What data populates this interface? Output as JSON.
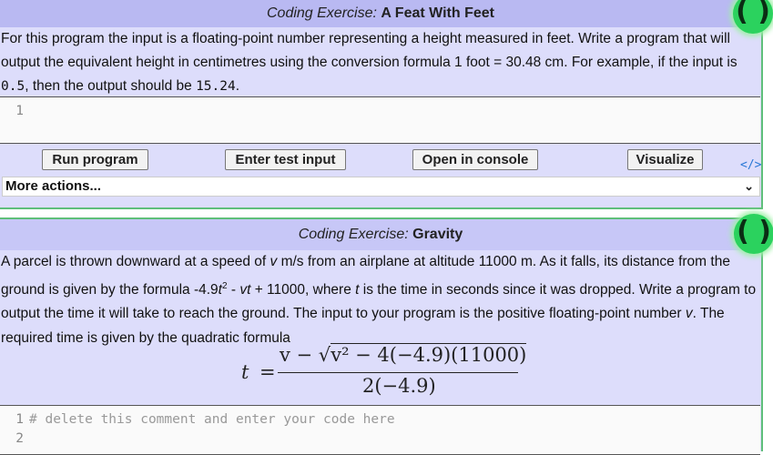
{
  "exercise1": {
    "title_prefix": "Coding Exercise:",
    "title_name": "A Feat With Feet",
    "desc_part1": "For this program the input is a floating-point number representing a height measured in feet. Write a program that will output the equivalent height in centimetres using the conversion formula 1 foot = 30.48 cm. For example, if the input is ",
    "example_input": "0.5",
    "desc_part2": ", then the output should be ",
    "example_output": "15.24",
    "desc_part3": ".",
    "editor_line_numbers": [
      "1"
    ],
    "editor_lines": [
      ""
    ],
    "buttons": {
      "run": "Run program",
      "test": "Enter test input",
      "console": "Open in console",
      "visualize": "Visualize"
    },
    "more_actions": "More actions...",
    "code_icon": "</>",
    "parens_icon": "( )"
  },
  "exercise2": {
    "title_prefix": "Coding Exercise:",
    "title_name": "Gravity",
    "desc_a": "A parcel is thrown downward at a speed of ",
    "var_v": "v",
    "desc_b": " m/s from an airplane at altitude 11000 m. As it falls, its distance from the ground is given by the formula -4.9",
    "var_t": "t",
    "sup2": "2",
    "desc_c": " - ",
    "var_vt": "vt",
    "desc_d": " + 11000, where ",
    "desc_e": " is the time in seconds since it was dropped. Write a program to output the time it will take to reach the ground. The input to your program is the positive floating-point number ",
    "desc_f": ". The required time is given by the quadratic formula",
    "formula": {
      "lhs": "t",
      "eq": "=",
      "num_pre": "v − √",
      "num_rad": "v² − 4(−4.9)(11000)",
      "den": "2(−4.9)"
    },
    "editor_line_numbers": [
      "1",
      "2"
    ],
    "editor_lines": [
      "# delete this comment and enter your code here",
      ""
    ],
    "parens_icon": "( )"
  }
}
